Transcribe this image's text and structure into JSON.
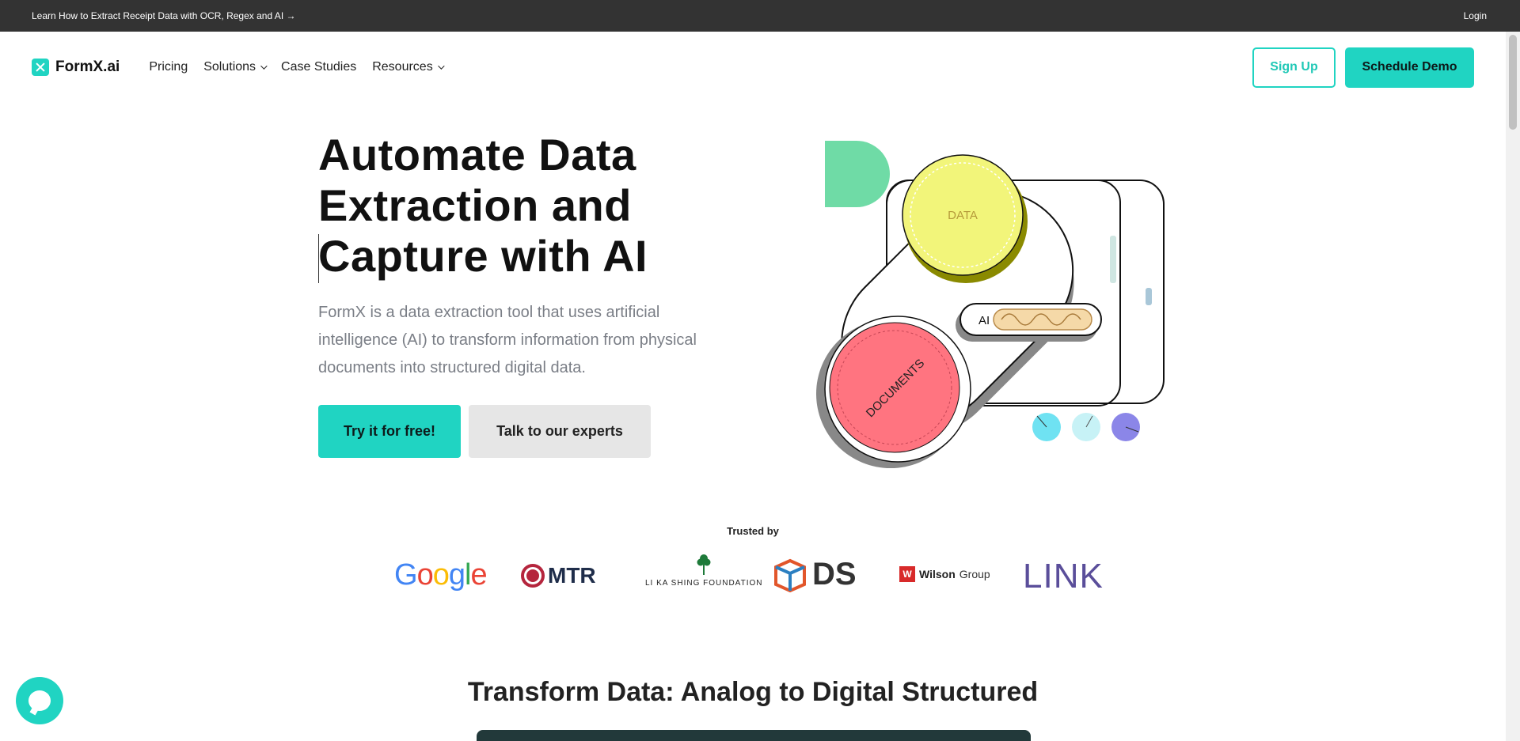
{
  "announcement": {
    "text": "Learn How to Extract Receipt Data with OCR, Regex and AI →",
    "login": "Login"
  },
  "nav": {
    "brand": "FormX.ai",
    "links": [
      "Pricing",
      "Solutions",
      "Case Studies",
      "Resources"
    ],
    "sign_up": "Sign Up",
    "schedule_demo": "Schedule Demo"
  },
  "hero": {
    "title_lines": [
      "Automate Data",
      "Extraction and",
      "Capture with AI"
    ],
    "subtitle": "FormX is a data extraction tool that uses artificial intelligence (AI) to transform information from physical documents into structured digital data.",
    "cta_primary": "Try it for free!",
    "cta_secondary": "Talk to our experts",
    "illustration": {
      "data_label": "DATA",
      "documents_label": "DOCUMENTS",
      "ai_label": "AI"
    }
  },
  "trusted": {
    "heading": "Trusted by",
    "logos": {
      "google": "Google",
      "mtr": "MTR",
      "lks": "LI KA SHING FOUNDATION",
      "ds": "DS",
      "wilson_name": "Wilson",
      "wilson_suffix": "Group",
      "link": "LINK"
    }
  },
  "section": {
    "title": "Transform Data: Analog to Digital Structured"
  },
  "colors": {
    "accent": "#20d4c2",
    "topbar": "#333333",
    "data_circle": "#f2f57a",
    "documents_circle": "#ff7480"
  }
}
